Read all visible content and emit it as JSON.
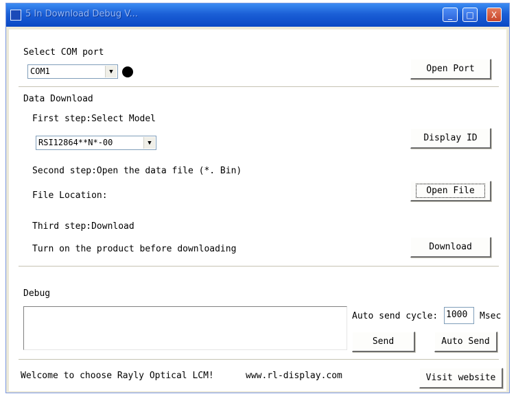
{
  "window": {
    "title": "5 In Download Debug V..."
  },
  "titlebar": {
    "minimize_glyph": "_",
    "maximize_glyph": "□",
    "close_glyph": "X"
  },
  "com": {
    "section_label": "Select COM port",
    "port_value": "COM1",
    "open_port_label": "Open Port"
  },
  "download": {
    "section_label": "Data Download",
    "step1_label": "First step:Select Model",
    "model_value": "RSI12864**N*-00",
    "display_id_label": "Display ID",
    "step2_label": "Second step:Open the data file (*. Bin)",
    "file_location_label": "File Location:",
    "open_file_label": "Open File",
    "step3_label": "Third step:Download",
    "turn_on_label": "Turn on the product before downloading",
    "download_label": "Download"
  },
  "debug": {
    "section_label": "Debug",
    "auto_send_cycle_label": "Auto send cycle:",
    "cycle_value": "1000",
    "msec_label": "Msec",
    "send_label": "Send",
    "auto_send_label": "Auto Send"
  },
  "footer": {
    "welcome_text": "Welcome to choose Rayly Optical LCM!",
    "website_text": "www.rl-display.com",
    "visit_label": "Visit website"
  },
  "colors": {
    "titlebar": "#1b5fd6",
    "window_bg": "#ece9d8"
  }
}
